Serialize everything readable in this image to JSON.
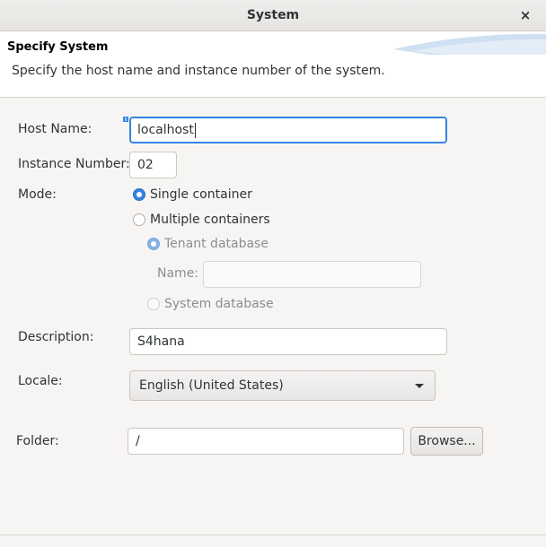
{
  "window": {
    "title": "System",
    "close_glyph": "×",
    "close_icon": "close-icon"
  },
  "banner": {
    "heading": "Specify System",
    "description": "Specify the host name and instance number of the system."
  },
  "form": {
    "host_name_label": "Host Name:",
    "host_name_value": "localhost",
    "instance_number_label": "Instance Number:",
    "instance_number_value": "02",
    "mode_label": "Mode:",
    "mode_single": "Single container",
    "mode_multiple": "Multiple containers",
    "tenant_database": "Tenant database",
    "name_label": "Name:",
    "name_value": "",
    "system_database": "System database",
    "description_label": "Description:",
    "description_value": "S4hana",
    "locale_label": "Locale:",
    "locale_value": "English (United States)",
    "folder_label": "Folder:",
    "folder_value": "/",
    "browse_label": "Browse..."
  },
  "colors": {
    "accent": "#3584e4",
    "background": "#f6f5f4"
  }
}
